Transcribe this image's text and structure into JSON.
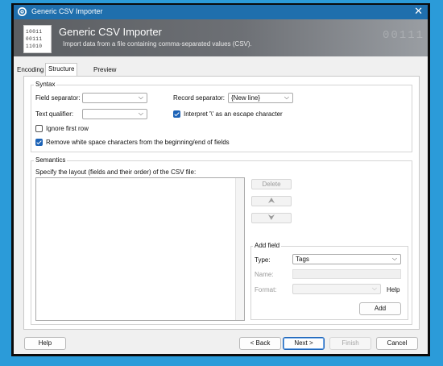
{
  "window": {
    "title": "Generic CSV Importer",
    "close_glyph": "✕"
  },
  "header": {
    "title": "Generic CSV Importer",
    "subtitle": "Import data from a file containing comma-separated values (CSV).",
    "logo_lines": [
      "10011",
      "00111",
      "11010"
    ],
    "deco_text": "00111"
  },
  "tabs": [
    {
      "label": "Encoding",
      "active": false
    },
    {
      "label": "Structure",
      "active": true
    },
    {
      "label": "Preview",
      "active": false
    }
  ],
  "syntax": {
    "group_label": "Syntax",
    "field_separator_label": "Field separator:",
    "field_separator_value": "",
    "text_qualifier_label": "Text qualifier:",
    "text_qualifier_value": "",
    "record_separator_label": "Record separator:",
    "record_separator_value": "{New line}",
    "interpret_escape_label": "Interpret '\\' as an escape character",
    "interpret_escape_checked": true,
    "ignore_first_row_label": "Ignore first row",
    "ignore_first_row_checked": false,
    "remove_whitespace_label": "Remove white space characters from the beginning/end of fields",
    "remove_whitespace_checked": true
  },
  "semantics": {
    "group_label": "Semantics",
    "layout_label": "Specify the layout (fields and their order) of the CSV file:",
    "fields": [],
    "delete_label": "Delete",
    "move_up_glyph": "⮝",
    "move_down_glyph": "⮟"
  },
  "add_field": {
    "group_label": "Add field",
    "type_label": "Type:",
    "type_value": "Tags",
    "name_label": "Name:",
    "format_label": "Format:",
    "help_label": "Help",
    "add_label": "Add"
  },
  "footer": {
    "help_label": "Help",
    "back_label": "< Back",
    "next_label": "Next >",
    "finish_label": "Finish",
    "cancel_label": "Cancel"
  },
  "colors": {
    "background": "#2b9bd9",
    "titlebar": "#1f6fad",
    "accent": "#1c63b7"
  },
  "icons": {
    "dropdown": "⌵"
  }
}
